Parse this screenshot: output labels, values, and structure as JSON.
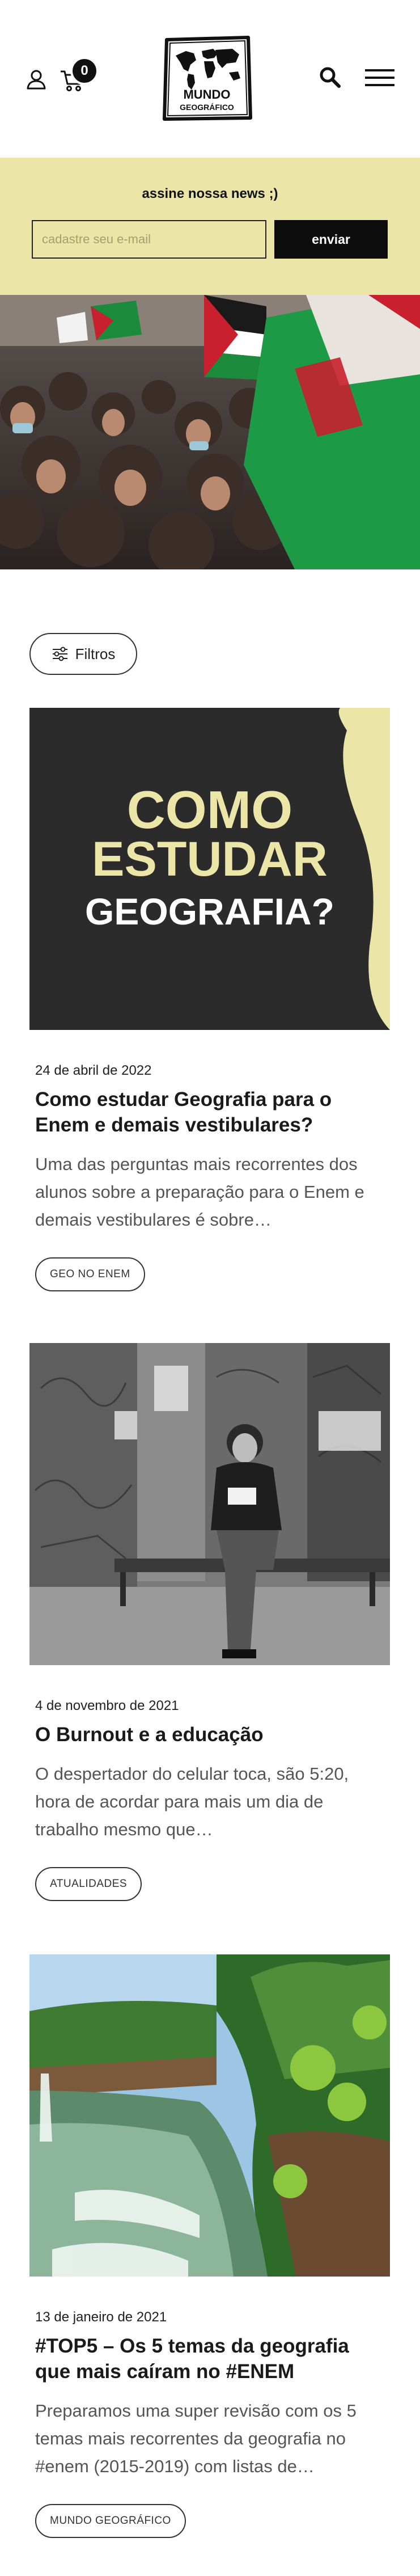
{
  "header": {
    "cart_count": "0",
    "logo_line1": "MUNDO",
    "logo_line2": "GEOGRÁFICO"
  },
  "newsletter": {
    "title": "assine nossa news ;)",
    "placeholder": "cadastre seu e-mail",
    "button": "enviar"
  },
  "filter": {
    "label": "Filtros"
  },
  "posts": [
    {
      "image_line1": "COMO",
      "image_line2": "ESTUDAR",
      "image_line3": "GEOGRAFIA?",
      "date": "24 de abril de 2022",
      "title": "Como estudar Geografia para o Enem e demais vestibulares?",
      "excerpt": "Uma das perguntas mais recorrentes dos alunos sobre a preparação para o Enem e demais vestibulares é sobre…",
      "tag": "GEO NO ENEM"
    },
    {
      "date": "4 de novembro de 2021",
      "title": "O Burnout e a educação",
      "excerpt": "O despertador do celular toca, são 5:20, hora de acordar para mais um dia de trabalho mesmo que…",
      "tag": "ATUALIDADES"
    },
    {
      "date": "13 de janeiro de 2021",
      "title": "#TOP5 – Os 5 temas da geografia que mais caíram no #ENEM",
      "excerpt": "Preparamos uma super revisão com os 5 temas mais recorrentes da geografia no #enem (2015-2019) com listas de…",
      "tag": "MUNDO GEOGRÁFICO"
    }
  ]
}
